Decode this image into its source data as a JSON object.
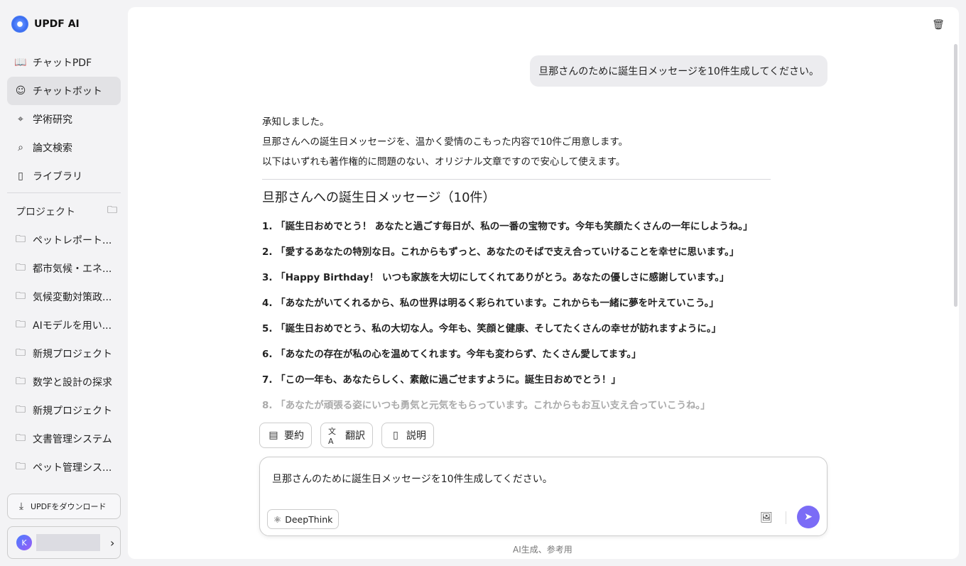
{
  "app": {
    "title": "UPDF AI"
  },
  "nav": [
    {
      "label": "チャットPDF",
      "icon": "chat-pdf-icon"
    },
    {
      "label": "チャットボット",
      "icon": "chatbot-icon"
    },
    {
      "label": "学術研究",
      "icon": "telescope-icon"
    },
    {
      "label": "論文検索",
      "icon": "search-doc-icon"
    },
    {
      "label": "ライブラリ",
      "icon": "library-icon"
    }
  ],
  "projects": {
    "heading": "プロジェクト",
    "items": [
      "ペットレポート...",
      "都市気候・エネ...",
      "気候変動対策政...",
      "AIモデルを用い...",
      "新規プロジェクト",
      "数学と設計の探求",
      "新規プロジェクト",
      "文書管理システム",
      "ペット管理シス..."
    ]
  },
  "download": "UPDFをダウンロード",
  "user": {
    "initial": "K"
  },
  "chat": {
    "user_message": "旦那さんのために誕生日メッセージを10件生成してください。",
    "intro": [
      "承知しました。",
      "旦那さんへの誕生日メッセージを、温かく愛情のこもった内容で10件ご用意します。",
      "以下はいずれも著作権的に問題のない、オリジナル文章ですので安心して使えます。"
    ],
    "heading": "旦那さんへの誕生日メッセージ（10件）",
    "messages": [
      "1. 「誕生日おめでとう！ あなたと過ごす毎日が、私の一番の宝物です。今年も笑顔たくさんの一年にしようね。」",
      "2. 「愛するあなたの特別な日。これからもずっと、あなたのそばで支え合っていけることを幸せに思います。」",
      "3. 「Happy Birthday！ いつも家族を大切にしてくれてありがとう。あなたの優しさに感謝しています。」",
      "4. 「あなたがいてくれるから、私の世界は明るく彩られています。これからも一緒に夢を叶えていこう。」",
      "5. 「誕生日おめでとう、私の大切な人。今年も、笑顔と健康、そしてたくさんの幸せが訪れますように。」",
      "6. 「あなたの存在が私の心を温めてくれます。今年も変わらず、たくさん愛してます。」",
      "7. 「この一年も、あなたらしく、素敵に過ごせますように。誕生日おめでとう！」",
      "8. 「あなたが頑張る姿にいつも勇気と元気をもらっています。これからもお互い支え合っていこうね。」"
    ]
  },
  "actions": [
    "要約",
    "翻訳",
    "説明"
  ],
  "input": {
    "value": "旦那さんのために誕生日メッセージを10件生成してください。",
    "deepthink": "DeepThink"
  },
  "footer": "AI生成、参考用",
  "colors": {
    "accent": "#7b6cf6"
  }
}
